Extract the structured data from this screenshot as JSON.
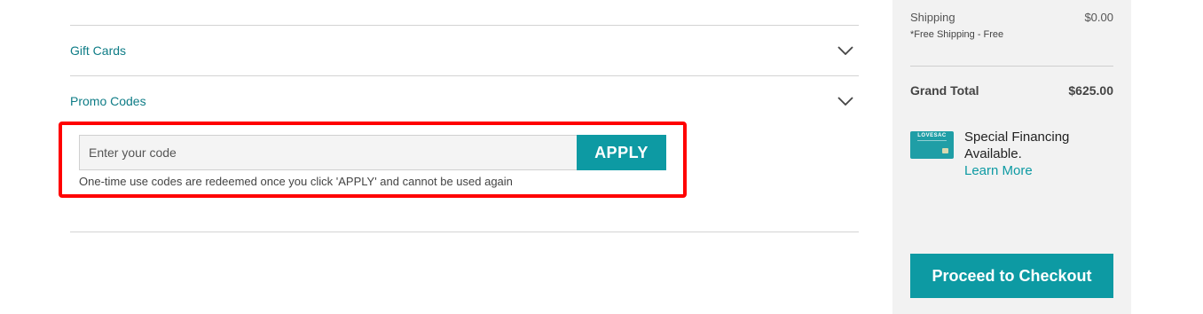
{
  "accordion": {
    "gift_cards_label": "Gift Cards",
    "promo_codes_label": "Promo Codes"
  },
  "promo": {
    "placeholder": "Enter your code",
    "value": "",
    "apply_label": "APPLY",
    "note": "One-time use codes are redeemed once you click 'APPLY' and cannot be used again"
  },
  "summary": {
    "shipping_label": "Shipping",
    "shipping_value": "$0.00",
    "shipping_note": "*Free Shipping - Free",
    "grand_total_label": "Grand Total",
    "grand_total_value": "$625.00",
    "card_brand": "LOVESAC",
    "financing_text": "Special Financing Available.",
    "financing_link": "Learn More",
    "checkout_label": "Proceed to Checkout"
  },
  "icons": {
    "gift_cards_toggle": "chevron-down-icon",
    "promo_codes_toggle": "chevron-down-icon"
  },
  "colors": {
    "accent": "#0d9aa3",
    "link_text": "#0e7c86",
    "highlight_border": "#ff0000",
    "summary_bg": "#f2f2f2"
  }
}
